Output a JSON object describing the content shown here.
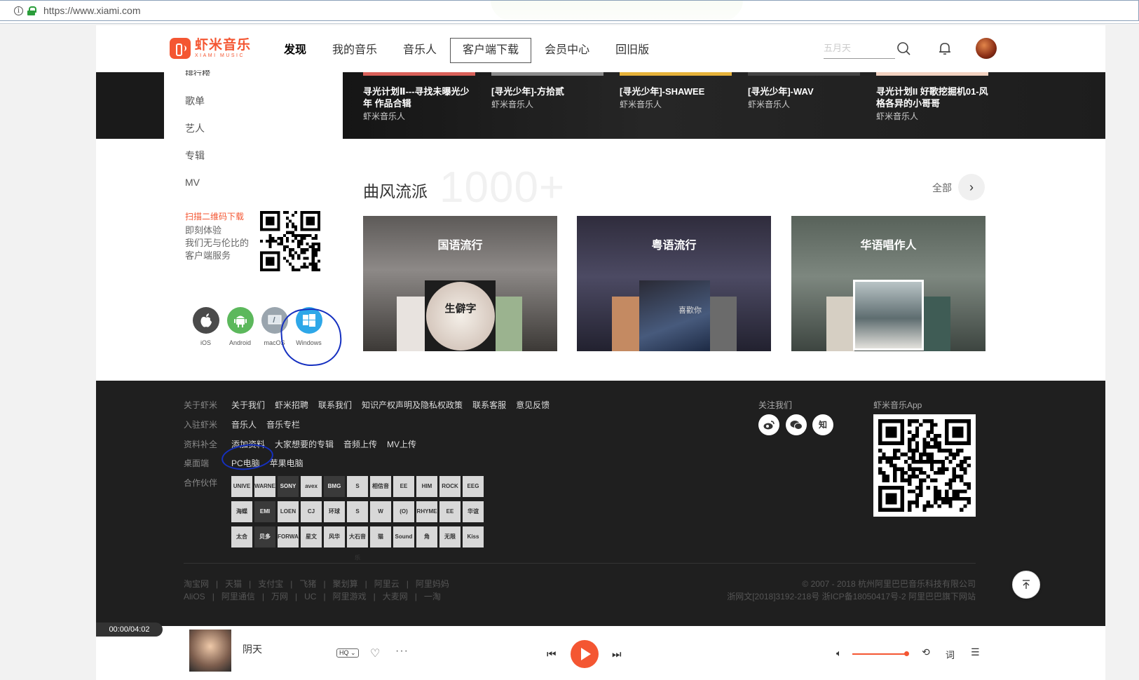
{
  "browser": {
    "url": "https://www.xiami.com"
  },
  "header": {
    "logo_cn": "虾米音乐",
    "logo_en": "XIAMI MUSIC",
    "nav": [
      "发现",
      "我的音乐",
      "音乐人",
      "客户端下载",
      "会员中心",
      "回旧版"
    ],
    "search_placeholder": "五月天"
  },
  "sidebar": {
    "cut_item": "排行榜",
    "items": [
      "歌单",
      "艺人",
      "专辑",
      "MV"
    ],
    "qr_title": "扫描二维码下载",
    "qr_desc": [
      "即刻体验",
      "我们无与伦比的",
      "客户端服务"
    ],
    "downloads": [
      {
        "label": "iOS",
        "icon": "apple-icon",
        "color": "#4a4a4a"
      },
      {
        "label": "Android",
        "icon": "android-icon",
        "color": "#5cb85c"
      },
      {
        "label": "macOS",
        "icon": "mac-icon",
        "color": "#9aa5ae"
      },
      {
        "label": "Windows",
        "icon": "windows-icon",
        "color": "#2ea7e8"
      }
    ]
  },
  "carousel": [
    {
      "title": "寻光计划Ⅱ---寻找未曝光少年 作品合辑",
      "sub": "虾米音乐人"
    },
    {
      "title": "[寻光少年]-方拾贰",
      "sub": "虾米音乐人"
    },
    {
      "title": "[寻光少年]-SHAWEE",
      "sub": "虾米音乐人"
    },
    {
      "title": "[寻光少年]-WAV",
      "sub": "虾米音乐人"
    },
    {
      "title": "寻光计划II 好歌挖掘机01-风格各异的小哥哥",
      "sub": "虾米音乐人"
    }
  ],
  "genre": {
    "title": "曲风流派",
    "bg_number": "1000+",
    "all_label": "全部",
    "cards": [
      {
        "name": "国语流行",
        "cover_text": "生僻字"
      },
      {
        "name": "粤语流行",
        "cover_text": "喜歡你"
      },
      {
        "name": "华语唱作人",
        "cover_text": ""
      }
    ]
  },
  "footer": {
    "rows": [
      {
        "label": "关于虾米",
        "links": [
          "关于我们",
          "虾米招聘",
          "联系我们",
          "知识产权声明及隐私权政策",
          "联系客服",
          "意见反馈"
        ]
      },
      {
        "label": "入驻虾米",
        "links": [
          "音乐人",
          "音乐专栏"
        ]
      },
      {
        "label": "资料补全",
        "links": [
          "添加资料",
          "大家想要的专辑",
          "音频上传",
          "MV上传"
        ]
      },
      {
        "label": "桌面端",
        "links": [
          "PC电脑",
          "苹果电脑"
        ]
      },
      {
        "label": "合作伙伴",
        "links": []
      }
    ],
    "partners": [
      "UNIVERSAL",
      "WARNER",
      "SONY",
      "avex",
      "BMG",
      "S",
      "相信音乐",
      "EE",
      "HIM",
      "ROCK",
      "EEG",
      "海蝶",
      "EMI",
      "LOEN",
      "CJ",
      "环球",
      "S",
      "W",
      "(O)",
      "RHYMEWORKS",
      "EE",
      "华谊",
      "太合",
      "贝多",
      "FORWARD",
      "星文",
      "风华",
      "大石音乐",
      "猫",
      "Sound",
      "角",
      "无限",
      "Kiss"
    ],
    "follow_title": "关注我们",
    "social": [
      "微博",
      "微信",
      "知"
    ],
    "app_title": "虾米音乐App",
    "bottom_links_1": [
      "淘宝网",
      "天猫",
      "支付宝",
      "飞猪",
      "聚划算",
      "阿里云",
      "阿里妈妈"
    ],
    "bottom_links_2": [
      "AliOS",
      "阿里通信",
      "万网",
      "UC",
      "阿里游戏",
      "大麦网",
      "一淘"
    ],
    "copyright_1": "© 2007 - 2018 杭州阿里巴巴音乐科技有限公司",
    "copyright_2": "浙网文[2018]3192-218号 浙ICP备18050417号-2 阿里巴巴旗下网站"
  },
  "player": {
    "time": "00:00/04:02",
    "song": "阴天",
    "quality": "HQ",
    "lyric_label": "词",
    "volume": 1.0
  }
}
